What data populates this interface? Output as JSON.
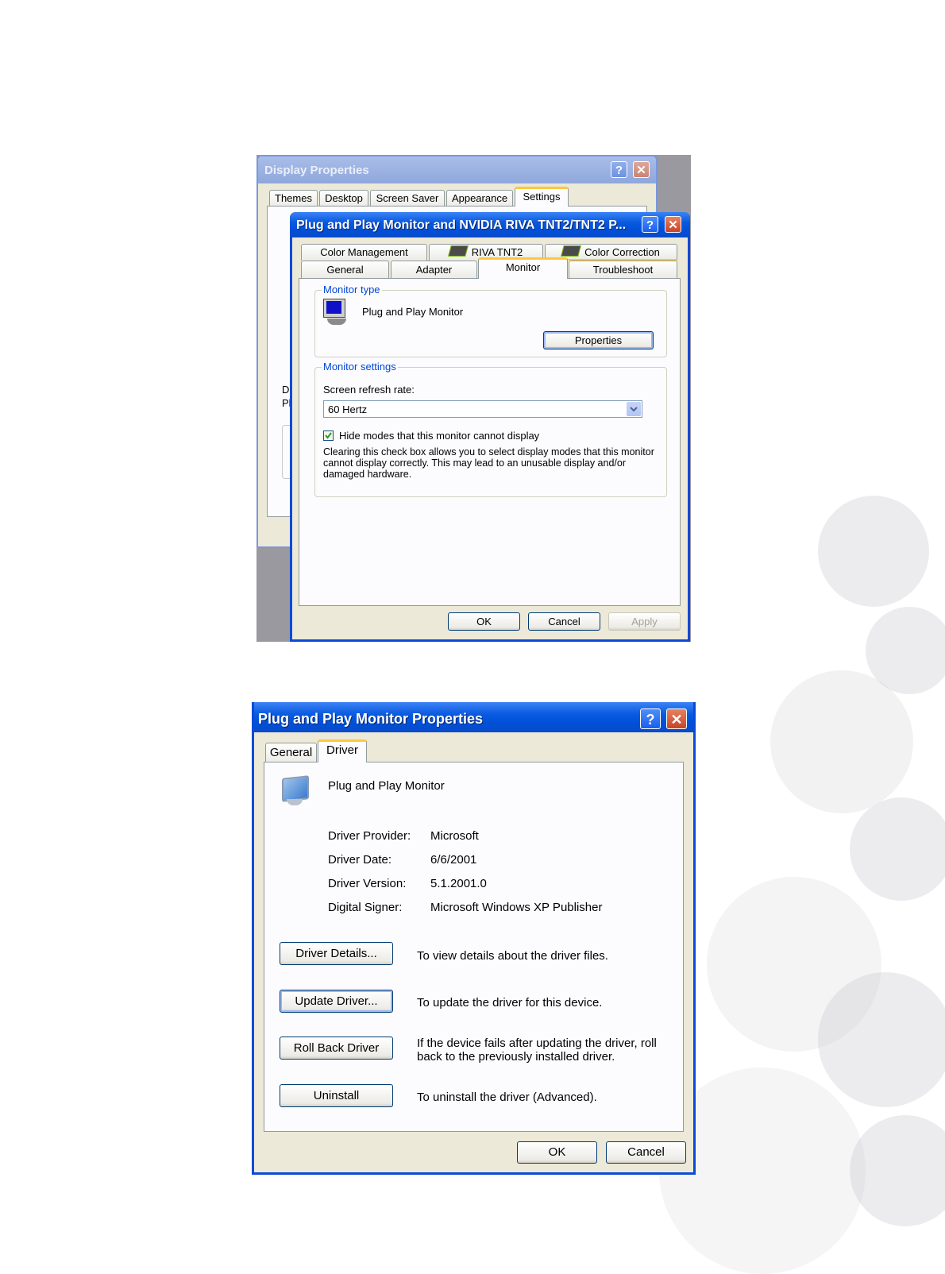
{
  "display_properties": {
    "title": "Display Properties",
    "help_glyph": "?",
    "close_glyph": "✕",
    "tabs": [
      "Themes",
      "Desktop",
      "Screen Saver",
      "Appearance",
      "Settings"
    ],
    "active_tab": "Settings",
    "partial_left_text": [
      "D",
      "Pl"
    ]
  },
  "monitor_dialog": {
    "title": "Plug and Play Monitor and NVIDIA RIVA TNT2/TNT2 P...",
    "tabs_row1": [
      "Color Management",
      "RIVA TNT2",
      "Color Correction"
    ],
    "tabs_row2": [
      "General",
      "Adapter",
      "Monitor",
      "Troubleshoot"
    ],
    "active_tab": "Monitor",
    "monitor_type": {
      "legend": "Monitor type",
      "name": "Plug and Play Monitor",
      "properties_button": "Properties"
    },
    "monitor_settings": {
      "legend": "Monitor settings",
      "refresh_label": "Screen refresh rate:",
      "refresh_value": "60 Hertz",
      "hide_modes_label": "Hide modes that this monitor cannot display",
      "hide_modes_checked": true,
      "warning_text": "Clearing this check box allows you to select display modes that this monitor cannot display correctly. This may lead to an unusable display and/or damaged hardware."
    },
    "buttons": {
      "ok": "OK",
      "cancel": "Cancel",
      "apply": "Apply"
    }
  },
  "driver_dialog": {
    "title": "Plug and Play Monitor Properties",
    "tabs": [
      "General",
      "Driver"
    ],
    "active_tab": "Driver",
    "device_name": "Plug and Play Monitor",
    "info": [
      {
        "label": "Driver Provider:",
        "value": "Microsoft"
      },
      {
        "label": "Driver Date:",
        "value": "6/6/2001"
      },
      {
        "label": "Driver Version:",
        "value": "5.1.2001.0"
      },
      {
        "label": "Digital Signer:",
        "value": "Microsoft Windows XP Publisher"
      }
    ],
    "actions": [
      {
        "button": "Driver Details...",
        "description": "To view details about the driver files."
      },
      {
        "button": "Update Driver...",
        "description": "To update the driver for this device."
      },
      {
        "button": "Roll Back Driver",
        "description": "If the device fails after updating the driver, roll back to the previously installed driver."
      },
      {
        "button": "Uninstall",
        "description": "To uninstall the driver (Advanced)."
      }
    ],
    "buttons": {
      "ok": "OK",
      "cancel": "Cancel"
    }
  },
  "colors": {
    "xp_blue": "#0a5ae0",
    "dialog_face": "#ece9d8",
    "tab_highlight": "#ffc83c",
    "groupbox_label": "#0046d5"
  },
  "icons": [
    "help-icon",
    "close-icon",
    "monitor-icon",
    "nvidia-icon",
    "dropdown-arrow-icon",
    "checkbox-checked-icon"
  ]
}
